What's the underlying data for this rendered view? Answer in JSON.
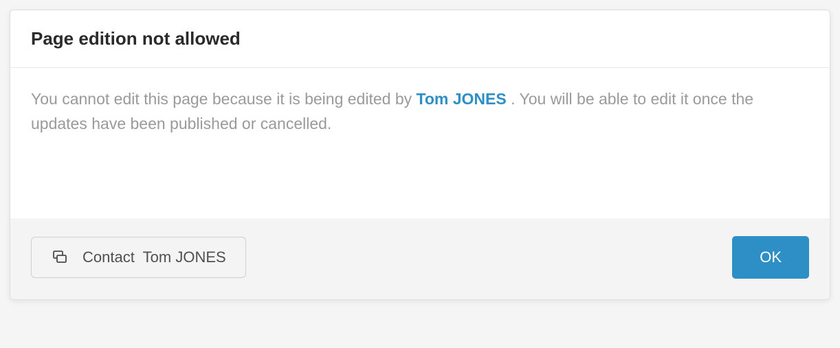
{
  "dialog": {
    "title": "Page edition not allowed",
    "message_before": "You cannot edit this page because it is being edited by ",
    "user_name": "Tom JONES",
    "message_after": " . You will be able to edit it once the updates have been published or cancelled.",
    "footer": {
      "contact_label": "Contact",
      "contact_user": "Tom JONES",
      "ok_label": "OK"
    }
  }
}
